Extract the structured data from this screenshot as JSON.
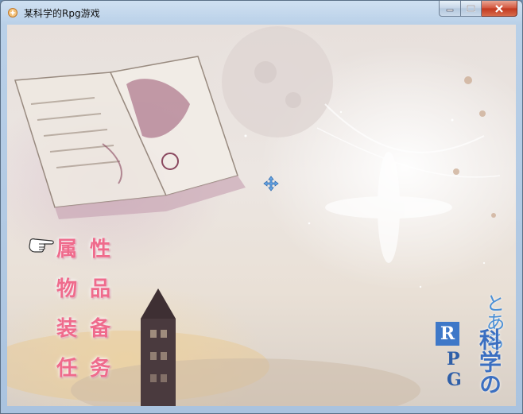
{
  "window": {
    "title": "某科学的Rpg游戏"
  },
  "menu": {
    "items": [
      {
        "label": "属性"
      },
      {
        "label": "物品"
      },
      {
        "label": "装备"
      },
      {
        "label": "任务"
      }
    ],
    "pointer_icon": "pointing-hand-icon"
  },
  "logo": {
    "hiragana": "とある",
    "kanji": "科学の",
    "rpg_letters": [
      "R",
      "P",
      "G"
    ]
  },
  "colors": {
    "menu_text": "#ef6b8c",
    "logo_blue": "#3e78c8"
  }
}
